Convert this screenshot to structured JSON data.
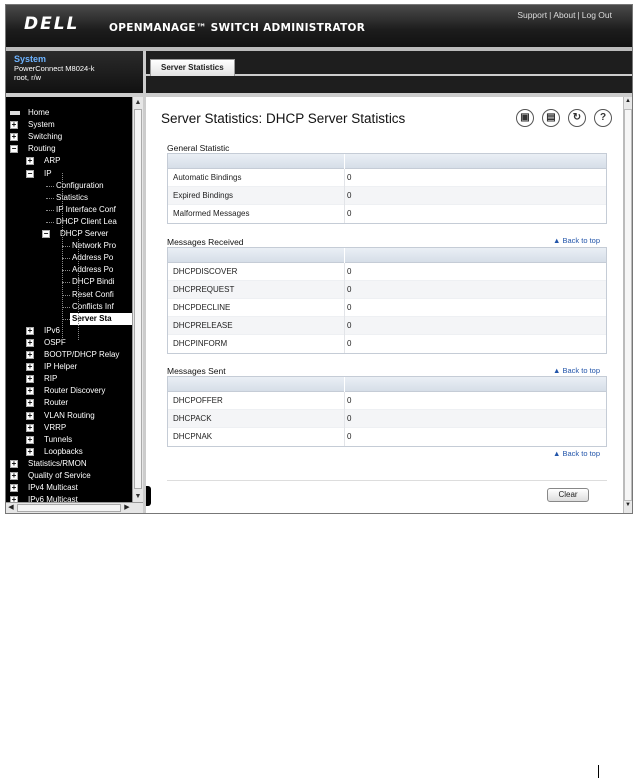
{
  "header": {
    "logo": "DELL",
    "product": "OPENMANAGE™ SWITCH ADMINISTRATOR",
    "links": [
      "Support",
      "About",
      "Log Out"
    ]
  },
  "system_box": {
    "title": "System",
    "model": "PowerConnect M8024-k",
    "user": "root, r/w"
  },
  "tab": {
    "label": "Server Statistics"
  },
  "nav": {
    "items": [
      {
        "label": "Home"
      },
      {
        "label": "System"
      },
      {
        "label": "Switching"
      },
      {
        "label": "Routing"
      },
      {
        "label": "ARP"
      },
      {
        "label": "IP"
      },
      {
        "label": "Configuration"
      },
      {
        "label": "Statistics"
      },
      {
        "label": "IP Interface Conf"
      },
      {
        "label": "DHCP Client Lea"
      },
      {
        "label": "DHCP Server"
      },
      {
        "label": "Network Pro"
      },
      {
        "label": "Address Po"
      },
      {
        "label": "Address Po"
      },
      {
        "label": "DHCP Bindi"
      },
      {
        "label": "Reset Confi"
      },
      {
        "label": "Conflicts Inf"
      },
      {
        "label": "Server Sta"
      },
      {
        "label": "IPv6"
      },
      {
        "label": "OSPF"
      },
      {
        "label": "BOOTP/DHCP Relay"
      },
      {
        "label": "IP Helper"
      },
      {
        "label": "RIP"
      },
      {
        "label": "Router Discovery"
      },
      {
        "label": "Router"
      },
      {
        "label": "VLAN Routing"
      },
      {
        "label": "VRRP"
      },
      {
        "label": "Tunnels"
      },
      {
        "label": "Loopbacks"
      },
      {
        "label": "Statistics/RMON"
      },
      {
        "label": "Quality of Service"
      },
      {
        "label": "IPv4 Multicast"
      },
      {
        "label": "IPv6 Multicast"
      }
    ]
  },
  "page": {
    "title": "Server Statistics: DHCP Server Statistics",
    "icons": [
      "save-icon",
      "print-icon",
      "refresh-icon",
      "help-icon"
    ],
    "back_to_top": "▲ Back to top",
    "clear_label": "Clear"
  },
  "general": {
    "title": "General Statistic",
    "rows": [
      {
        "label": "Automatic Bindings",
        "value": "0"
      },
      {
        "label": "Expired Bindings",
        "value": "0"
      },
      {
        "label": "Malformed Messages",
        "value": "0"
      }
    ]
  },
  "received": {
    "title": "Messages Received",
    "rows": [
      {
        "label": "DHCPDISCOVER",
        "value": "0"
      },
      {
        "label": "DHCPREQUEST",
        "value": "0"
      },
      {
        "label": "DHCPDECLINE",
        "value": "0"
      },
      {
        "label": "DHCPRELEASE",
        "value": "0"
      },
      {
        "label": "DHCPINFORM",
        "value": "0"
      }
    ]
  },
  "sent": {
    "title": "Messages Sent",
    "rows": [
      {
        "label": "DHCPOFFER",
        "value": "0"
      },
      {
        "label": "DHCPACK",
        "value": "0"
      },
      {
        "label": "DHCPNAK",
        "value": "0"
      }
    ]
  }
}
